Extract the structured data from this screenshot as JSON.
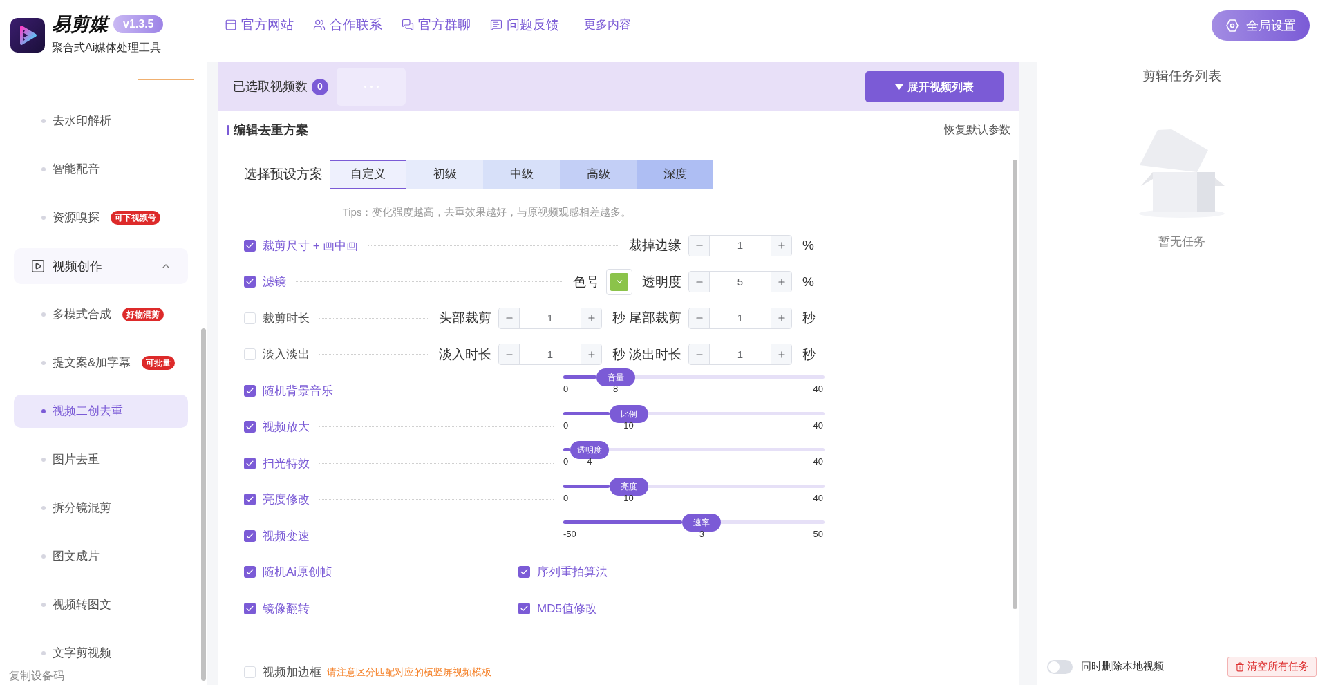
{
  "app": {
    "name": "易剪媒",
    "version": "v1.3.5",
    "subtitle": "聚合式Ai媒体处理工具"
  },
  "nav": [
    {
      "label": "官方网站"
    },
    {
      "label": "合作联系"
    },
    {
      "label": "官方群聊"
    },
    {
      "label": "问题反馈"
    },
    {
      "label": "更多内容"
    }
  ],
  "settings_button": "全局设置",
  "sidebar": {
    "items": [
      {
        "kind": "item",
        "label": "去水印解析",
        "selected": false
      },
      {
        "kind": "item",
        "label": "智能配音",
        "selected": false
      },
      {
        "kind": "item",
        "label": "资源嗅探",
        "badge": "可下视频号",
        "selected": false
      },
      {
        "kind": "group",
        "label": "视频创作",
        "expanded": true
      },
      {
        "kind": "item",
        "label": "多模式合成",
        "badge": "好物混剪",
        "selected": false
      },
      {
        "kind": "item",
        "label": "提文案&加字幕",
        "badge": "可批量",
        "selected": false
      },
      {
        "kind": "item",
        "label": "视频二创去重",
        "selected": true
      },
      {
        "kind": "item",
        "label": "图片去重",
        "selected": false
      },
      {
        "kind": "item",
        "label": "拆分镜混剪",
        "selected": false
      },
      {
        "kind": "item",
        "label": "图文成片",
        "selected": false
      },
      {
        "kind": "item",
        "label": "视频转图文",
        "selected": false
      },
      {
        "kind": "item",
        "label": "文字剪视频",
        "selected": false
      }
    ],
    "footer": "复制设备码"
  },
  "selection_bar": {
    "label": "已选取视频数",
    "count": "0",
    "button": "展开视频列表"
  },
  "editor": {
    "title": "编辑去重方案",
    "reset": "恢复默认参数",
    "preset_label": "选择预设方案",
    "presets": [
      {
        "label": "自定义",
        "selected": true
      },
      {
        "label": "初级",
        "selected": false
      },
      {
        "label": "中级",
        "selected": false
      },
      {
        "label": "高级",
        "selected": false
      },
      {
        "label": "深度",
        "selected": false
      }
    ],
    "tips": "Tips：变化强度越高，去重效果越好，与原视频观感相差越多。",
    "rows": [
      {
        "kind": "fields",
        "label": "裁剪尺寸 + 画中画",
        "checked": true,
        "fields": [
          {
            "kind": "stepper",
            "label": "裁掉边缘",
            "value": "1",
            "unit": "%"
          }
        ]
      },
      {
        "kind": "fields",
        "label": "滤镜",
        "checked": true,
        "fields": [
          {
            "kind": "color",
            "label": "色号",
            "color": "#8bc34a"
          },
          {
            "kind": "stepper",
            "label": "透明度",
            "value": "5",
            "unit": "%"
          }
        ]
      },
      {
        "kind": "fields",
        "label": "裁剪时长",
        "checked": false,
        "fields": [
          {
            "kind": "stepper",
            "label": "头部裁剪",
            "value": "1",
            "unit": "秒"
          },
          {
            "kind": "stepper",
            "label": "尾部裁剪",
            "value": "1",
            "unit": "秒"
          }
        ]
      },
      {
        "kind": "fields",
        "label": "淡入淡出",
        "checked": false,
        "fields": [
          {
            "kind": "stepper",
            "label": "淡入时长",
            "value": "1",
            "unit": "秒"
          },
          {
            "kind": "stepper",
            "label": "淡出时长",
            "value": "1",
            "unit": "秒"
          }
        ]
      },
      {
        "kind": "slider",
        "label": "随机背景音乐",
        "checked": true,
        "thumb": "音量",
        "min": "0",
        "value": "8",
        "max": "40",
        "level": 0.2
      },
      {
        "kind": "slider",
        "label": "视频放大",
        "checked": true,
        "thumb": "比例",
        "min": "0",
        "value": "10",
        "max": "40",
        "level": 0.25
      },
      {
        "kind": "slider",
        "label": "扫光特效",
        "checked": true,
        "thumb": "透明度",
        "min": "0",
        "value": "4",
        "max": "40",
        "level": 0.1
      },
      {
        "kind": "slider",
        "label": "亮度修改",
        "checked": true,
        "thumb": "亮度",
        "min": "0",
        "value": "10",
        "max": "40",
        "level": 0.25
      },
      {
        "kind": "slider",
        "label": "视频变速",
        "checked": true,
        "thumb": "速率",
        "min": "-50",
        "value": "3",
        "max": "50",
        "level": 0.53
      },
      {
        "kind": "pair",
        "items": [
          {
            "label": "随机Ai原创帧",
            "checked": true
          },
          {
            "label": "序列重拍算法",
            "checked": true
          }
        ]
      },
      {
        "kind": "pair",
        "items": [
          {
            "label": "镜像翻转",
            "checked": true
          },
          {
            "label": "MD5值修改",
            "checked": true
          }
        ]
      },
      {
        "kind": "note",
        "label": "视频加边框",
        "checked": false,
        "note": "请注意区分匹配对应的横竖屏视频模板"
      }
    ]
  },
  "tasks": {
    "title": "剪辑任务列表",
    "empty": "暂无任务",
    "toggle": {
      "label": "同时删除本地视频",
      "on": false
    },
    "clear_button": "清空所有任务"
  }
}
